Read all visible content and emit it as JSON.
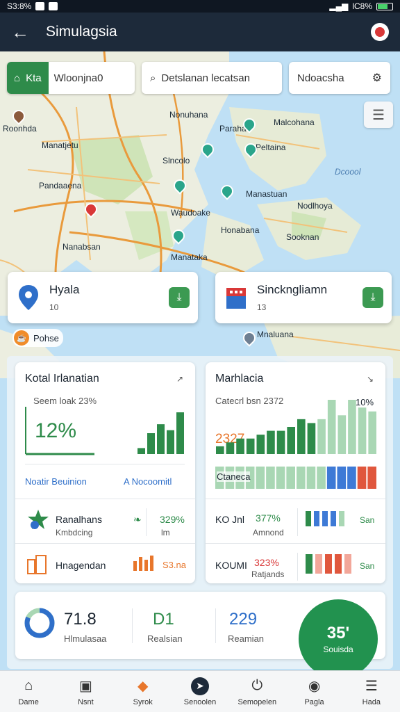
{
  "status_bar": {
    "time": "S3:8%",
    "battery": "lC8%"
  },
  "app_bar": {
    "title": "Simulagsia"
  },
  "search": {
    "chip_label": "Kta",
    "chip_value": "Wloonjna0",
    "search_text": "Detslanan lecatsan",
    "filter_text": "Ndoacsha"
  },
  "map_labels": [
    "Roonhda",
    "Manatjetu",
    "Pandaaena",
    "Nanabsan",
    "Nonuhana",
    "Slncolo",
    "Waudoake",
    "Manataka",
    "Malcohana",
    "Peltaina",
    "Manastuan",
    "Nodlhoya",
    "Honabana",
    "Sooknan",
    "Mnaluana",
    "Paraha",
    "Dcoool"
  ],
  "location_cards": [
    {
      "name": "Hyala",
      "count": "10"
    },
    {
      "name": "Sinckngliamn",
      "count": "13"
    }
  ],
  "pohse_label": "Pohse",
  "panel_left": {
    "title": "Kotal Irlanatian",
    "subtitle": "Seem loak 23%",
    "big_value": "12%",
    "footer_left": "Noatir Beuinion",
    "footer_right": "A Nocoomitl",
    "rows": [
      {
        "name": "Ranalhans",
        "sub": "Kmbdcing",
        "value": "329%",
        "unit": "lm"
      },
      {
        "name": "Hnagendan",
        "sub": "",
        "value": "S3.na",
        "unit": ""
      }
    ]
  },
  "panel_right": {
    "title": "Marhlacia",
    "subtitle": "Catecrl bsn 2372",
    "big_value": "2327",
    "peak_value": "10%",
    "legend_label": "Ctaneca",
    "rows": [
      {
        "name": "KO Jnl",
        "sub": "Amnond",
        "value": "377%",
        "unit": "San"
      },
      {
        "name": "KOUMI",
        "sub": "Ratjands",
        "value": "323%",
        "unit": "San"
      }
    ]
  },
  "summary": {
    "items": [
      {
        "value": "71.8",
        "label": "Hlmulasaa"
      },
      {
        "value": "D1",
        "label": "Realsian"
      },
      {
        "value": "229",
        "label": "Reamian"
      }
    ],
    "fab_value": "35'",
    "fab_label": "Souisda",
    "donut_fraction": 0.82
  },
  "chart_left_bars": [
    2,
    7,
    10,
    8,
    14
  ],
  "chart_right_bars": [
    2,
    3,
    4,
    4,
    5,
    6,
    6,
    7,
    9,
    8,
    9,
    14,
    10,
    14,
    12,
    11
  ],
  "chart_right_strip": [
    "#a9d7b4",
    "#a9d7b4",
    "#a9d7b4",
    "#a9d7b4",
    "#a9d7b4",
    "#a9d7b4",
    "#a9d7b4",
    "#a9d7b4",
    "#a9d7b4",
    "#a9d7b4",
    "#a9d7b4",
    "#3e7ad6",
    "#3e7ad6",
    "#3e7ad6",
    "#e0573d",
    "#e0573d"
  ],
  "nav": [
    {
      "label": "Dame",
      "icon": "home-icon"
    },
    {
      "label": "Nsnt",
      "icon": "briefcase-icon"
    },
    {
      "label": "Syrok",
      "icon": "pin-icon"
    },
    {
      "label": "Senoolen",
      "icon": "compass-icon"
    },
    {
      "label": "Semopelen",
      "icon": "power-icon"
    },
    {
      "label": "Pagla",
      "icon": "location-icon"
    },
    {
      "label": "Hada",
      "icon": "menu-icon"
    }
  ],
  "colors": {
    "accent_green": "#2e8b4a",
    "appbar": "#1d2a3a",
    "blue": "#2f6fc9",
    "orange": "#e8762b"
  }
}
